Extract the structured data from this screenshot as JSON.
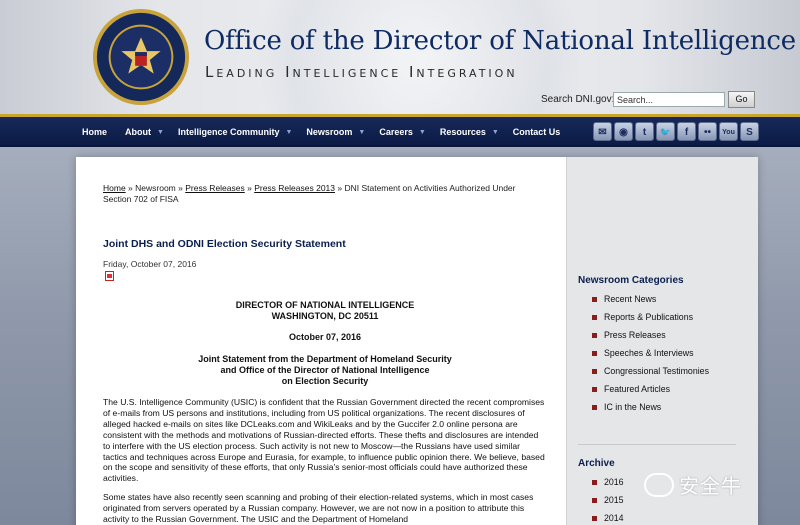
{
  "header": {
    "title": "Office of the Director of National Intelligence",
    "tagline": "Leading Intelligence Integration",
    "search_label": "Search DNI.gov:",
    "search_value": "Search...",
    "search_button": "Go"
  },
  "nav": {
    "items": [
      {
        "label": "Home",
        "dropdown": false
      },
      {
        "label": "About",
        "dropdown": true
      },
      {
        "label": "Intelligence Community",
        "dropdown": true
      },
      {
        "label": "Newsroom",
        "dropdown": true
      },
      {
        "label": "Careers",
        "dropdown": true
      },
      {
        "label": "Resources",
        "dropdown": true
      },
      {
        "label": "Contact Us",
        "dropdown": false
      }
    ],
    "socials": [
      "email-icon",
      "rss-icon",
      "tumblr-icon",
      "twitter-icon",
      "facebook-icon",
      "flickr-icon",
      "youtube-icon",
      "scribd-icon"
    ],
    "social_glyphs": [
      "✉",
      "◉",
      "t",
      "🐦",
      "f",
      "••",
      "You",
      "S"
    ]
  },
  "breadcrumb": {
    "home": "Home",
    "sep": " » ",
    "newsroom": "Newsroom",
    "press_releases": "Press Releases",
    "press_releases_2013": "Press Releases 2013",
    "current": "DNI Statement on Activities Authorized Under Section 702 of FISA"
  },
  "article": {
    "title": "Joint DHS and ODNI Election Security Statement",
    "date": "Friday, October 07, 2016",
    "heading_line1": "DIRECTOR OF NATIONAL INTELLIGENCE",
    "heading_line2": "WASHINGTON, DC 20511",
    "heading_date": "October 07, 2016",
    "subhead_line1": "Joint Statement from the Department of Homeland Security",
    "subhead_line2": "and Office of the Director of National Intelligence",
    "subhead_line3": "on Election Security",
    "para1": "The U.S. Intelligence Community (USIC) is confident that the Russian Government directed the recent compromises of e-mails from US persons and institutions, including from US political organizations. The recent disclosures of alleged hacked e-mails on sites like DCLeaks.com and WikiLeaks and by the Guccifer 2.0 online persona are consistent with the methods and motivations of Russian-directed efforts. These thefts and disclosures are intended to interfere with the US election process. Such activity is not new to Moscow—the Russians have used similar tactics and techniques across Europe and Eurasia, for example, to influence public opinion there. We believe, based on the scope and sensitivity of these efforts, that only Russia's senior-most officials could have authorized these activities.",
    "para2": "Some states have also recently seen scanning and probing of their election-related systems, which in most cases originated from servers operated by a Russian company. However, we are not now in a position to attribute this activity to the Russian Government. The USIC and the Department of Homeland"
  },
  "sidebar": {
    "categories_title": "Newsroom Categories",
    "categories": [
      "Recent News",
      "Reports & Publications",
      "Press Releases",
      "Speeches & Interviews",
      "Congressional Testimonies",
      "Featured Articles",
      "IC in the News"
    ],
    "archive_title": "Archive",
    "archive": [
      "2016",
      "2015",
      "2014"
    ]
  },
  "watermark": {
    "text": "安全牛"
  }
}
